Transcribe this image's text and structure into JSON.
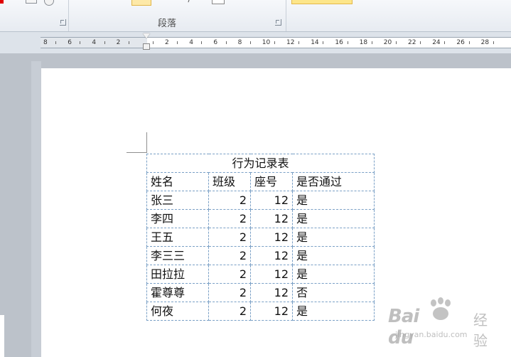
{
  "ribbon": {
    "group_label": "段落"
  },
  "ruler": {
    "labels": [
      "8",
      "6",
      "4",
      "2",
      "",
      "2",
      "4",
      "6",
      "8",
      "10",
      "12",
      "14",
      "16",
      "18",
      "20",
      "22",
      "24",
      "26",
      "28"
    ]
  },
  "table": {
    "title": "行为记录表",
    "headers": [
      "姓名",
      "班级",
      "座号",
      "是否通过"
    ],
    "rows": [
      [
        "张三",
        "2",
        "12",
        "是"
      ],
      [
        "李四",
        "2",
        "12",
        "是"
      ],
      [
        "王五",
        "2",
        "12",
        "是"
      ],
      [
        "李三三",
        "2",
        "12",
        "是"
      ],
      [
        "田拉拉",
        "2",
        "12",
        "是"
      ],
      [
        "霍尊尊",
        "2",
        "12",
        "否"
      ],
      [
        "何夜",
        "2",
        "12",
        "是"
      ]
    ]
  },
  "watermark": {
    "brand": "Bai du",
    "cn": "经验",
    "url": "jingyan.baidu.com"
  },
  "icons": {
    "launcher": "dialog-launcher-icon",
    "indent": "indent-marker-icon",
    "paw": "baidu-paw-icon"
  }
}
